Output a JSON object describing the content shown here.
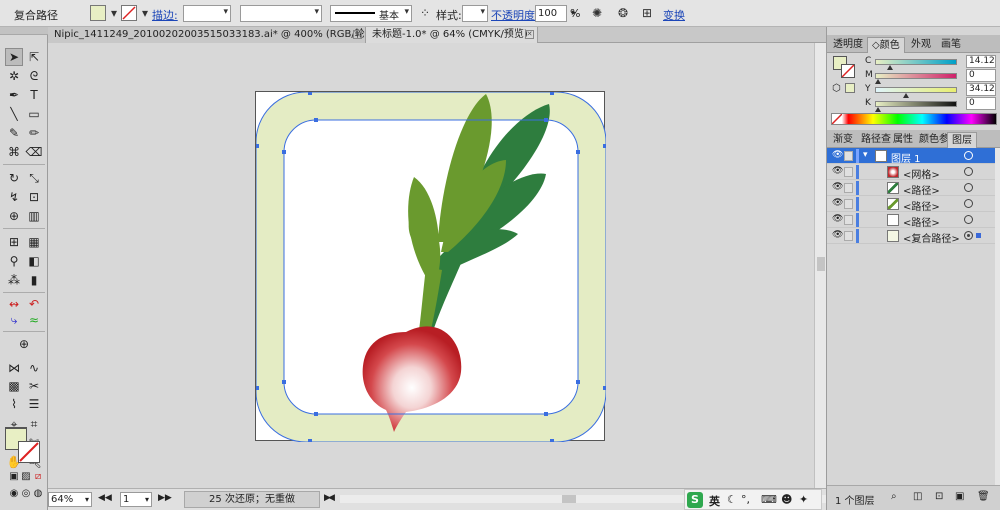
{
  "control_bar": {
    "selection_label": "复合路径",
    "stroke_link": "描边:",
    "stroke_weight": "",
    "stroke_profile": "基本",
    "style_label": "样式:",
    "opacity_link": "不透明度:",
    "opacity_value": "100",
    "opacity_unit": "%",
    "transform_link": "变换"
  },
  "tabs": [
    {
      "label": "Nipic_1411249_20100202003515033183.ai* @ 400% (RGB/轮廓)",
      "active": false
    },
    {
      "label": "未标题-1.0* @ 64% (CMYK/预览)",
      "active": true
    }
  ],
  "colors": {
    "fill": "#e8efc4",
    "frame": "#e4ecc4",
    "leaf_dark": "#2e7d3e",
    "leaf_light": "#6a9a2e",
    "radish_red": "#c0262b",
    "selection": "#3a6ee0"
  },
  "color_panel": {
    "tabs": [
      "透明度",
      "颜色",
      "外观",
      "画笔"
    ],
    "active_tab": "颜色",
    "channels": [
      {
        "name": "C",
        "value": "14.12"
      },
      {
        "name": "M",
        "value": "0"
      },
      {
        "name": "Y",
        "value": "34.12"
      },
      {
        "name": "K",
        "value": "0"
      }
    ]
  },
  "layers_panel": {
    "tabs": [
      "渐变",
      "路径查",
      "属性",
      "颜色参",
      "图层"
    ],
    "active_tab": "图层",
    "rows": [
      {
        "label": "图层 1",
        "selected": true
      },
      {
        "label": "<网格>",
        "selected": false
      },
      {
        "label": "<路径>",
        "selected": false
      },
      {
        "label": "<路径>",
        "selected": false
      },
      {
        "label": "<路径>",
        "selected": false
      },
      {
        "label": "<复合路径>",
        "selected": false
      }
    ],
    "footer_count": "1 个图层"
  },
  "status_bar": {
    "zoom": "64%",
    "artboard": "1",
    "history": "25 次还原；无重做"
  },
  "ime": {
    "logo": "S",
    "lang": "英"
  }
}
